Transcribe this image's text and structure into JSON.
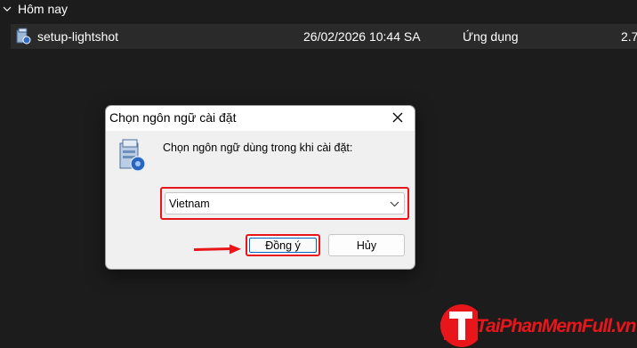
{
  "group": {
    "title": "Hôm nay"
  },
  "file": {
    "name": "setup-lightshot",
    "date": "26/02/2026 10:44 SA",
    "type": "Ứng dụng",
    "size": "2.7"
  },
  "dialog": {
    "title": "Chọn ngôn ngữ cài đặt",
    "prompt": "Chọn ngôn ngữ dùng trong khi cài đặt:",
    "selected_language": "Vietnam",
    "ok_label": "Đồng ý",
    "cancel_label": "Hủy"
  },
  "watermark": {
    "brand": "TaiPhanMemFull.vn"
  },
  "colors": {
    "highlight": "#e8161b",
    "background": "#1c1c1c",
    "dialog": "#f0f0f0"
  }
}
